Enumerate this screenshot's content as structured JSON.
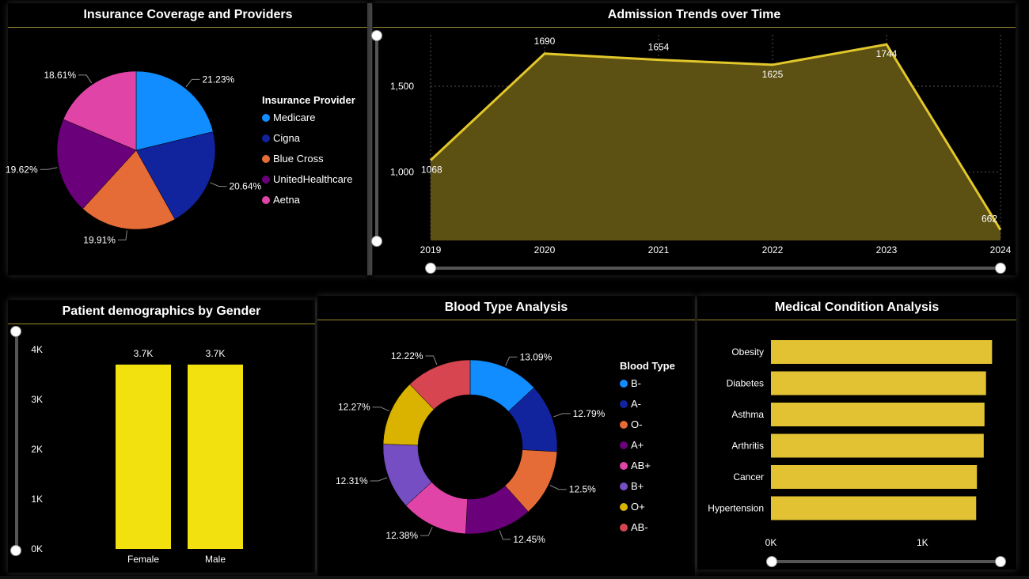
{
  "insurance": {
    "title": "Insurance Coverage and Providers",
    "legend_title": "Insurance Provider"
  },
  "admissions": {
    "title": "Admission Trends over Time"
  },
  "gender": {
    "title": "Patient demographics by Gender"
  },
  "blood": {
    "title": "Blood Type Analysis",
    "legend_title": "Blood Type"
  },
  "conditions": {
    "title": "Medical Condition Analysis"
  },
  "chart_data": [
    {
      "type": "pie",
      "title": "Insurance Coverage and Providers",
      "legend_title": "Insurance Provider",
      "legend_position": "right",
      "slices": [
        {
          "label": "Medicare",
          "value": 21.23,
          "display": "21.23%",
          "color": "#118DFF"
        },
        {
          "label": "Cigna",
          "value": 20.64,
          "display": "20.64%",
          "color": "#12239E"
        },
        {
          "label": "Blue Cross",
          "value": 19.91,
          "display": "19.91%",
          "color": "#E66C37"
        },
        {
          "label": "UnitedHealthcare",
          "value": 19.62,
          "display": "19.62%",
          "color": "#6B007B"
        },
        {
          "label": "Aetna",
          "value": 18.61,
          "display": "18.61%",
          "color": "#E044A7"
        }
      ]
    },
    {
      "type": "area",
      "title": "Admission Trends over Time",
      "x": [
        "2019",
        "2020",
        "2021",
        "2022",
        "2023",
        "2024"
      ],
      "values": [
        1068,
        1690,
        1654,
        1625,
        1744,
        662
      ],
      "data_labels": [
        "1068",
        "1690",
        "1654",
        "1625",
        "1744",
        "662"
      ],
      "ylim": [
        600,
        1800
      ],
      "y_ticks": [
        1000,
        1500
      ],
      "y_tick_labels": [
        "1,000",
        "1,500"
      ],
      "grid": true,
      "line_color": "#E2C72B",
      "fill_color": "#5C5013"
    },
    {
      "type": "bar",
      "title": "Patient demographics by Gender",
      "categories": [
        "Female",
        "Male"
      ],
      "values": [
        3.7,
        3.7
      ],
      "data_labels": [
        "3.7K",
        "3.7K"
      ],
      "ylim": [
        0,
        4
      ],
      "y_tick_labels": [
        "0K",
        "1K",
        "2K",
        "3K",
        "4K"
      ],
      "bar_color": "#F2E00F"
    },
    {
      "type": "pie",
      "title": "Blood Type Analysis",
      "legend_title": "Blood Type",
      "legend_position": "right",
      "donut": true,
      "slices": [
        {
          "label": "B-",
          "value": 13.09,
          "display": "13.09%",
          "color": "#118DFF"
        },
        {
          "label": "A-",
          "value": 12.79,
          "display": "12.79%",
          "color": "#12239E"
        },
        {
          "label": "O-",
          "value": 12.5,
          "display": "12.5%",
          "color": "#E66C37"
        },
        {
          "label": "A+",
          "value": 12.45,
          "display": "12.45%",
          "color": "#6B007B"
        },
        {
          "label": "AB+",
          "value": 12.38,
          "display": "12.38%",
          "color": "#E044A7"
        },
        {
          "label": "B+",
          "value": 12.31,
          "display": "12.31%",
          "color": "#744EC2"
        },
        {
          "label": "O+",
          "value": 12.27,
          "display": "12.27%",
          "color": "#D9B300"
        },
        {
          "label": "AB-",
          "value": 12.22,
          "display": "12.22%",
          "color": "#D64550"
        }
      ]
    },
    {
      "type": "bar",
      "orientation": "horizontal",
      "title": "Medical Condition Analysis",
      "categories": [
        "Obesity",
        "Diabetes",
        "Asthma",
        "Arthritis",
        "Cancer",
        "Hypertension"
      ],
      "values": [
        1460,
        1420,
        1410,
        1405,
        1360,
        1355
      ],
      "x_tick_values": [
        0,
        1000
      ],
      "x_tick_labels": [
        "0K",
        "1K"
      ],
      "xlim": [
        0,
        1500
      ],
      "bar_color": "#E2C233"
    }
  ]
}
